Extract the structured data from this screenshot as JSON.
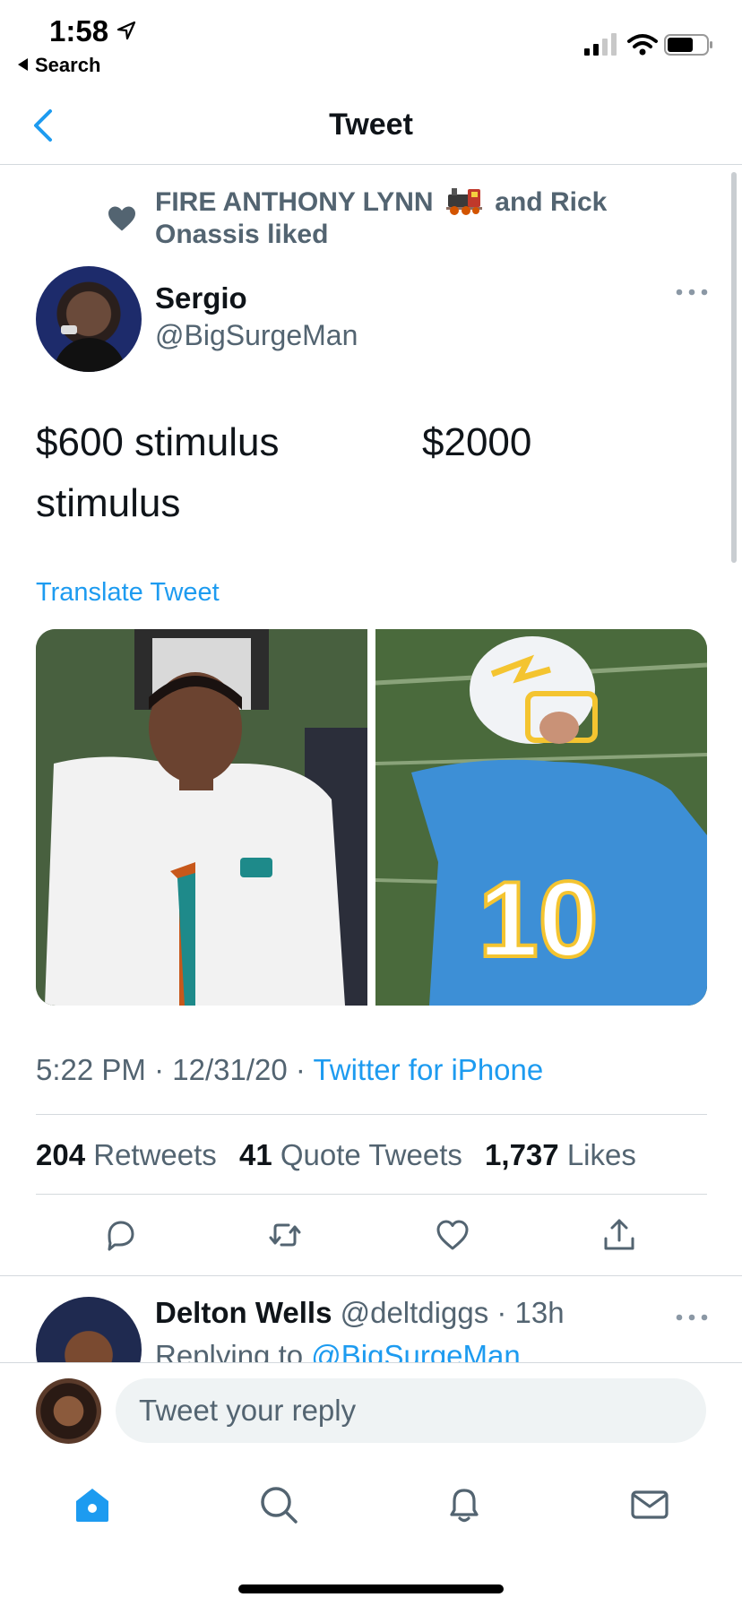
{
  "status_bar": {
    "time": "1:58",
    "back_label": "Search"
  },
  "nav": {
    "title": "Tweet"
  },
  "social_context": {
    "text_before": "FIRE ANTHONY LYNN",
    "text_after": "and Rick Onassis liked"
  },
  "tweet": {
    "author_name": "Sergio",
    "author_handle": "@BigSurgeMan",
    "text_part1": "$600 stimulus",
    "text_part2": "$2000",
    "text_part3": "stimulus",
    "translate_label": "Translate Tweet",
    "meta_time": "5:22 PM",
    "meta_date": "12/31/20",
    "meta_source": "Twitter for iPhone",
    "stats": {
      "retweets_count": "204",
      "retweets_label": "Retweets",
      "quotes_count": "41",
      "quotes_label": "Quote Tweets",
      "likes_count": "1,737",
      "likes_label": "Likes"
    }
  },
  "reply": {
    "name": "Delton Wells",
    "handle": "@deltdiggs",
    "time": "13h",
    "replying_prefix": "Replying to",
    "replying_mention": "@BigSurgeMan"
  },
  "composer": {
    "placeholder": "Tweet your reply"
  },
  "colors": {
    "accent": "#1d9bf0",
    "secondary_text": "#536471",
    "primary_text": "#0f1419"
  },
  "icons": {
    "tabs": [
      "home-icon",
      "search-icon",
      "notifications-icon",
      "messages-icon"
    ],
    "actions": [
      "reply-icon",
      "retweet-icon",
      "like-icon",
      "share-icon"
    ]
  }
}
